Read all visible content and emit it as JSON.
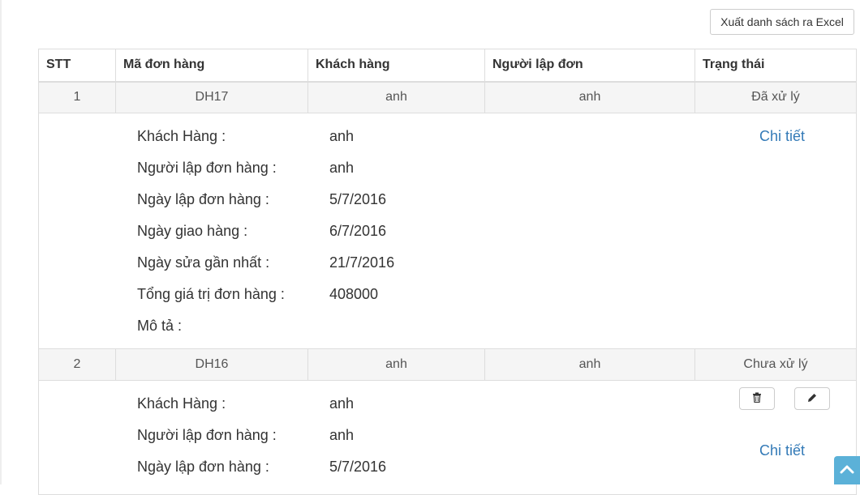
{
  "toolbar": {
    "export_label": "Xuất danh sách ra Excel"
  },
  "table": {
    "headers": [
      "STT",
      "Mã đơn hàng",
      "Khách hàng",
      "Người lập đơn",
      "Trạng thái"
    ],
    "orders": [
      {
        "stt": "1",
        "code": "DH17",
        "customer": "anh",
        "creator": "anh",
        "status": "Đã xử lý",
        "details": [
          {
            "label": "Khách Hàng :",
            "value": "anh"
          },
          {
            "label": "Người lập đơn hàng :",
            "value": "anh"
          },
          {
            "label": "Ngày lập đơn hàng :",
            "value": "5/7/2016"
          },
          {
            "label": "Ngày giao hàng :",
            "value": "6/7/2016"
          },
          {
            "label": "Ngày sửa gần nhất :",
            "value": "21/7/2016"
          },
          {
            "label": "Tổng giá trị đơn hàng :",
            "value": "408000"
          },
          {
            "label": "Mô tả :",
            "value": ""
          }
        ],
        "detail_link": "Chi tiết"
      },
      {
        "stt": "2",
        "code": "DH16",
        "customer": "anh",
        "creator": "anh",
        "status": "Chưa xử lý",
        "details": [
          {
            "label": "Khách Hàng :",
            "value": "anh"
          },
          {
            "label": "Người lập đơn hàng :",
            "value": "anh"
          },
          {
            "label": "Ngày lập đơn hàng :",
            "value": "5/7/2016"
          }
        ],
        "detail_link": "Chi tiết",
        "actions": {
          "delete_icon": "trash-icon",
          "edit_icon": "pencil-icon"
        }
      }
    ]
  },
  "colors": {
    "link": "#337ab7",
    "scroll_button": "#5bb1d8",
    "row_bg": "#f5f5f5",
    "border": "#dddddd"
  }
}
